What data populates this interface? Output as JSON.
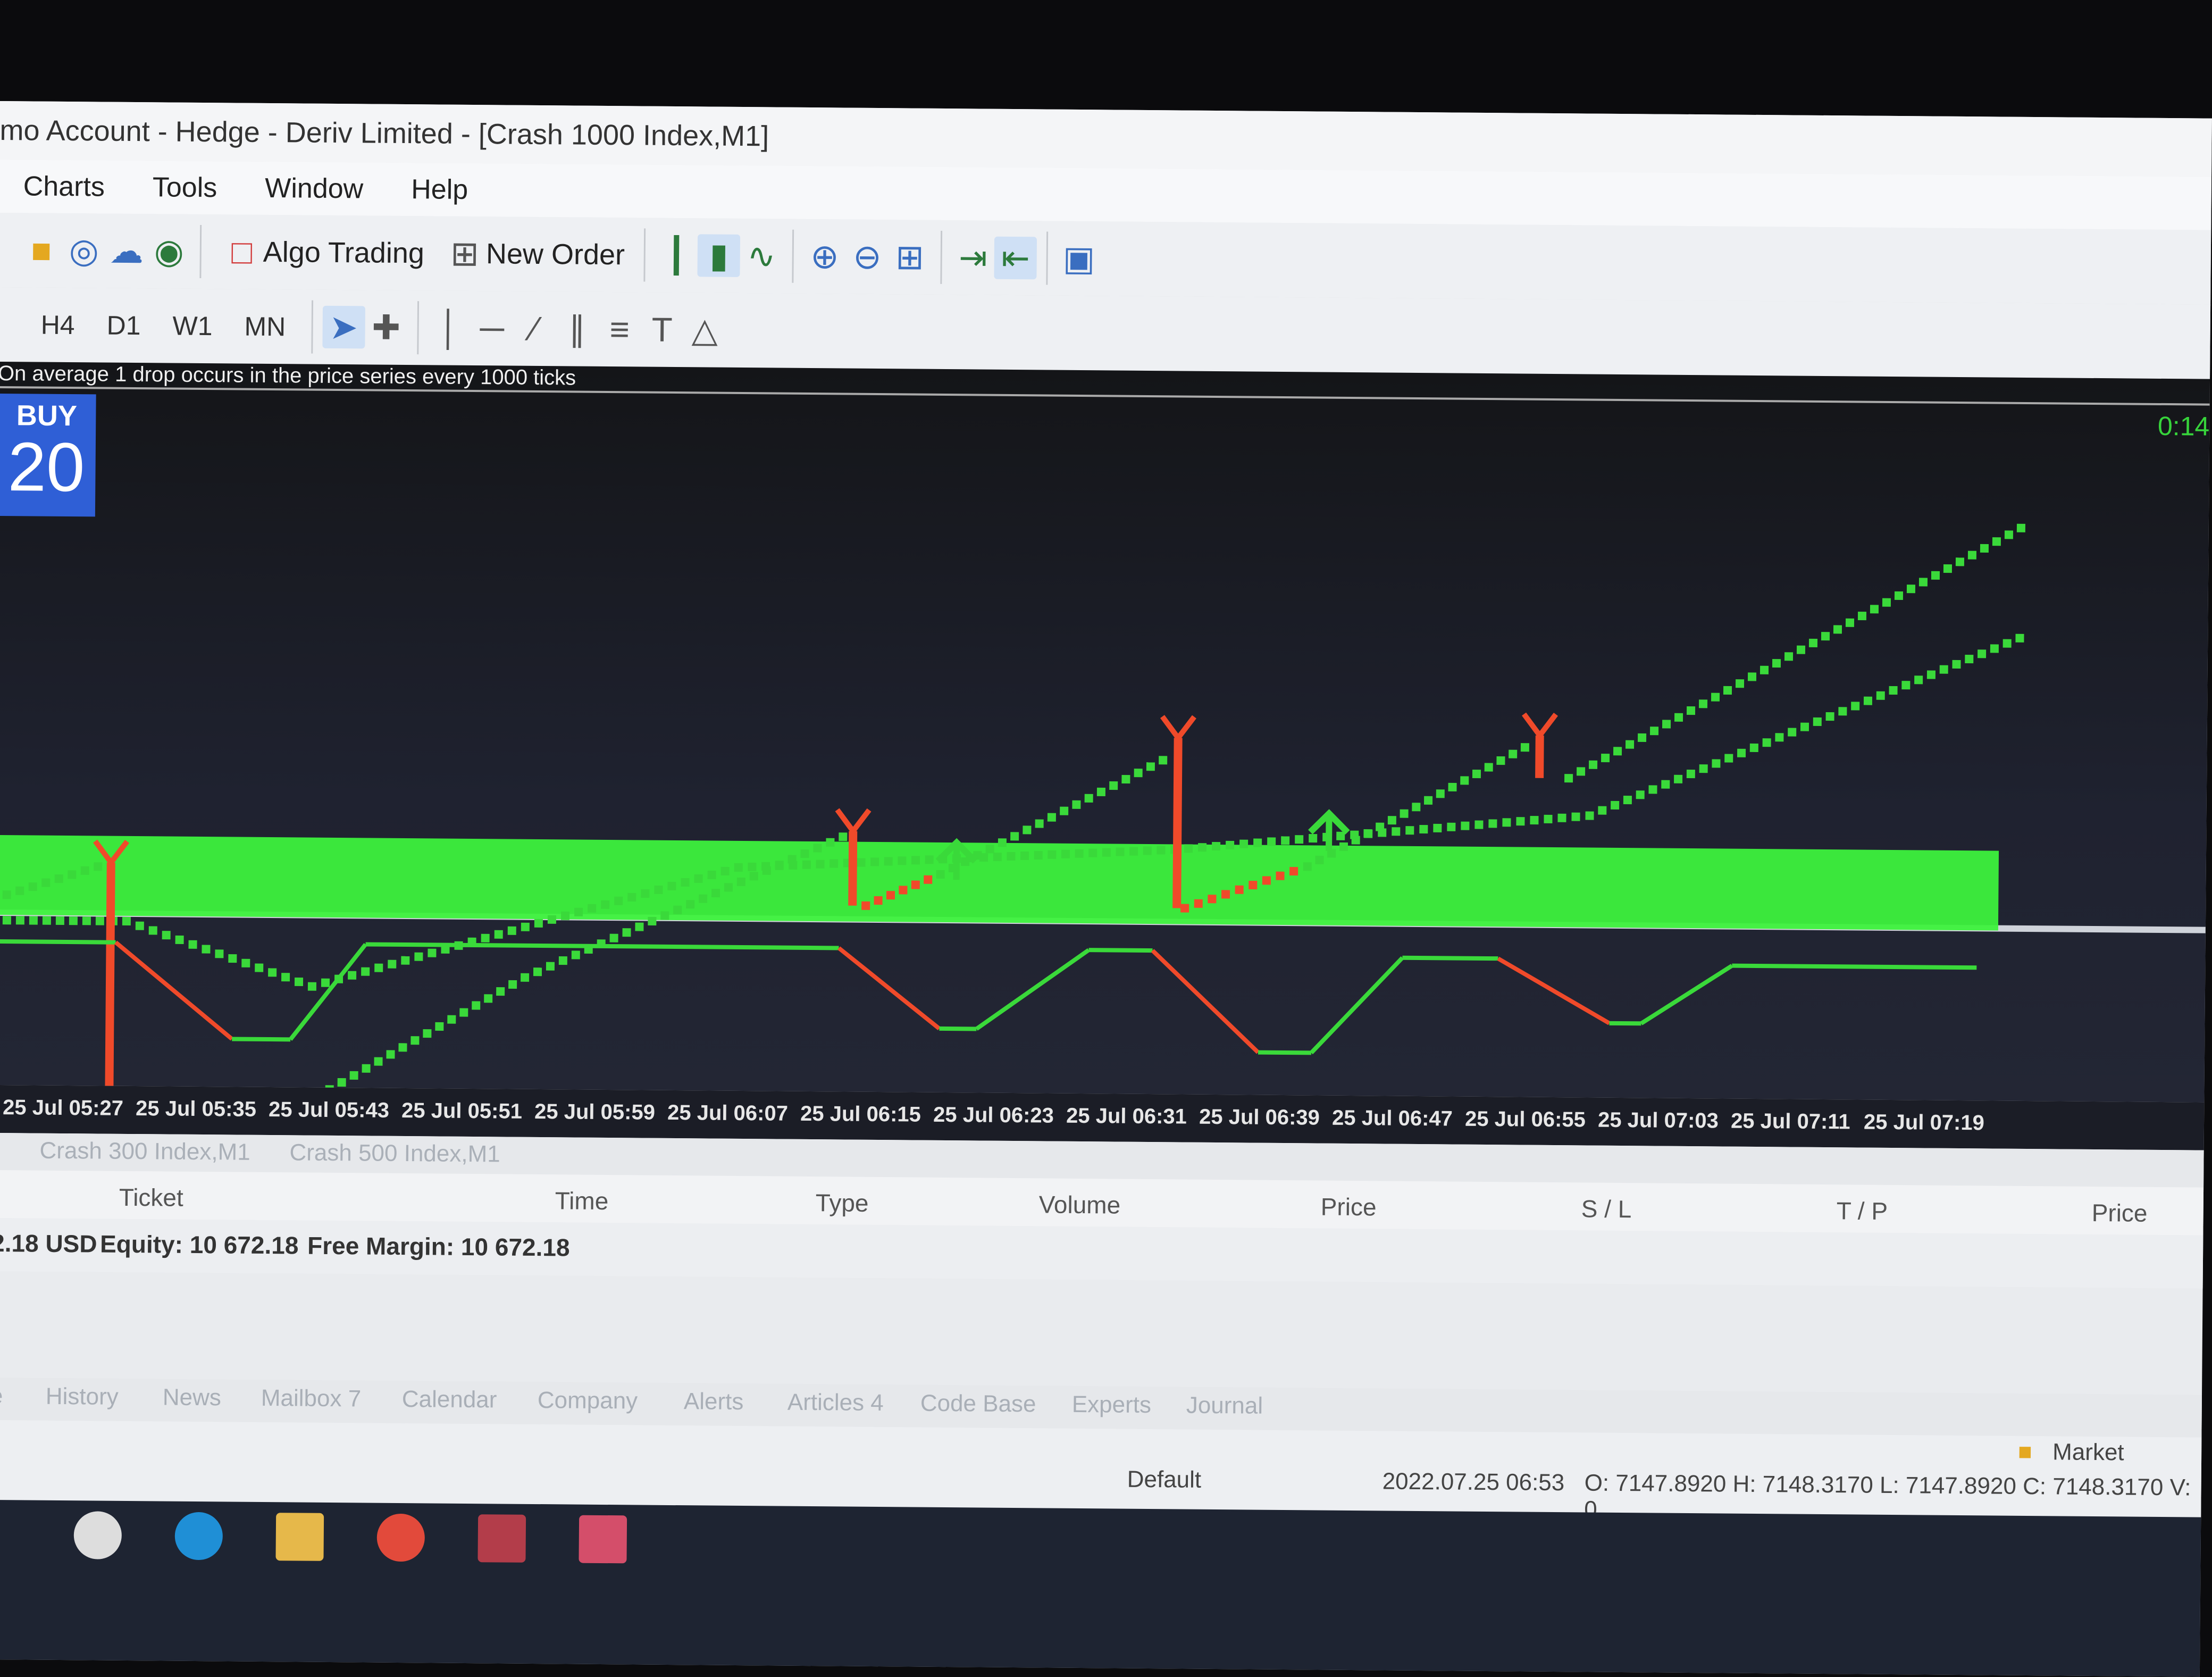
{
  "window": {
    "title": "mo Account - Hedge - Deriv Limited - [Crash 1000 Index,M1]"
  },
  "menu": [
    "Charts",
    "Tools",
    "Window",
    "Help"
  ],
  "toolbar": {
    "icons": [
      "market-icon",
      "signal-icon",
      "cloud-icon",
      "vps-icon"
    ],
    "algo_trading_label": "Algo Trading",
    "new_order_label": "New Order",
    "view_icons": [
      "bar-chart-icon",
      "candlestick-icon",
      "line-chart-icon",
      "zoom-in-icon",
      "zoom-out-icon",
      "grid-icon",
      "autoscroll-icon",
      "chart-shift-icon",
      "screenshot-icon"
    ]
  },
  "timeframes": [
    "H4",
    "D1",
    "W1",
    "MN"
  ],
  "chart": {
    "description": "On average 1 drop occurs in the price series every 1000 ticks",
    "buy_label": "BUY",
    "buy_volume": "20",
    "timer": "0:14",
    "x_ticks": [
      "25 Jul 05:27",
      "25 Jul 05:35",
      "25 Jul 05:43",
      "25 Jul 05:51",
      "25 Jul 05:59",
      "25 Jul 06:07",
      "25 Jul 06:15",
      "25 Jul 06:23",
      "25 Jul 06:31",
      "25 Jul 06:39",
      "25 Jul 06:47",
      "25 Jul 06:55",
      "25 Jul 07:03",
      "25 Jul 07:11",
      "25 Jul 07:19"
    ],
    "colors": {
      "up": "#3ad93a",
      "down": "#f04a2a",
      "zone": "#3df23d"
    }
  },
  "chart_tabs": [
    "Crash 300 Index,M1",
    "Crash 500 Index,M1"
  ],
  "trade_columns": [
    "Ticket",
    "Time",
    "Type",
    "Volume",
    "Price",
    "S / L",
    "T / P",
    "Price"
  ],
  "account_line": {
    "balance": "2.18 USD",
    "equity": "Equity: 10 672.18",
    "free_margin": "Free Margin: 10 672.18"
  },
  "toolbox_tabs": [
    "e",
    "History",
    "News",
    "Mailbox 7",
    "Calendar",
    "Company",
    "Alerts",
    "Articles 4",
    "Code Base",
    "Experts",
    "Journal"
  ],
  "status": {
    "market": "Market",
    "profile": "Default",
    "datetime": "2022.07.25 06:53",
    "ohlc": "O: 7147.8920  H: 7148.3170  L: 7147.8920  C: 7148.3170  V: 0"
  }
}
